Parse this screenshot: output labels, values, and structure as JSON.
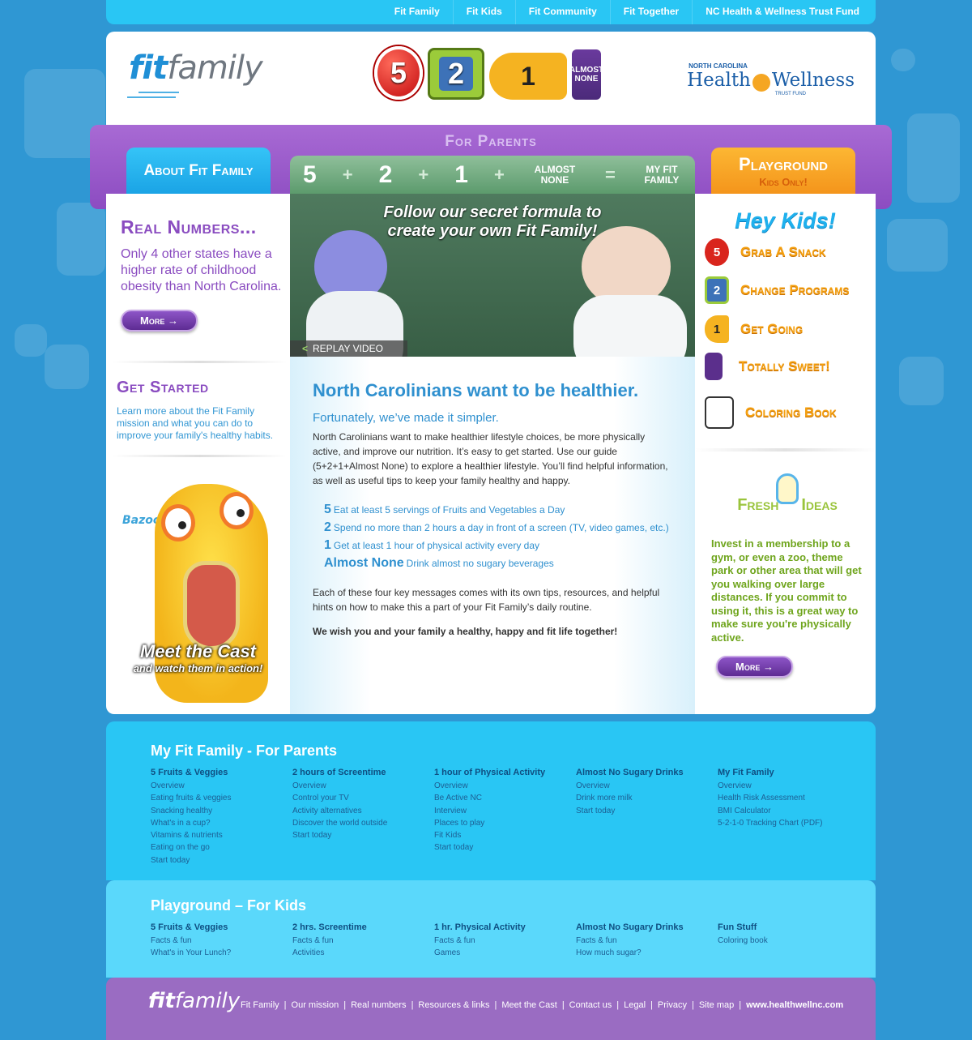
{
  "top_nav": [
    "Fit Family",
    "Fit Kids",
    "Fit Community",
    "Fit Together",
    "NC Health & Wellness Trust Fund"
  ],
  "logo": {
    "fit": "fit",
    "family": "family"
  },
  "badges": {
    "five": "5",
    "two": "2",
    "one": "1",
    "none": "ALMOST NONE"
  },
  "trust": {
    "nc": "NORTH CAROLINA",
    "health": "Health",
    "wellness": "Wellness",
    "fund": "TRUST FUND"
  },
  "band": {
    "for_parents": "For Parents",
    "about_tab": "About Fit Family",
    "playground_tab": "Playground",
    "kids_only": "Kids Only!",
    "formula": {
      "five": "5",
      "two": "2",
      "one": "1",
      "plus": "+",
      "equals": "=",
      "almost_none": "ALMOST NONE",
      "my_fit_family": "MY FIT FAMILY"
    }
  },
  "real_numbers": {
    "title": "Real Numbers...",
    "text": "Only 4 other states have a higher rate of childhood obesity than North Carolina.",
    "more": "More →"
  },
  "get_started": {
    "title": "Get Started",
    "text": "Learn more about the Fit Family mission and what you can do to improve your family's healthy habits."
  },
  "cast": {
    "name": "Bazoo",
    "line1": "Meet the Cast",
    "line2": "and watch them in action!"
  },
  "video": {
    "caption": "Follow our secret formula to create your own Fit Family!",
    "replay_arrow": "<",
    "replay": "REPLAY VIDEO"
  },
  "article": {
    "title": "North Carolinians want to be healthier.",
    "subtitle": "Fortunately, we’ve made it simpler.",
    "intro": "North Carolinians want to make healthier lifestyle choices, be more physically active, and improve our nutrition. It’s easy to get started. Use our guide (5+2+1+Almost None) to explore a healthier lifestyle. You’ll find helpful information, as well as useful tips to keep your family healthy and happy.",
    "items": [
      {
        "key": "5",
        "text": "Eat at least 5 servings of Fruits and Vegetables a Day"
      },
      {
        "key": "2",
        "text": "Spend no more than 2 hours a day in front of a screen (TV, video games, etc.)"
      },
      {
        "key": "1",
        "text": "Get at least 1 hour of physical activity every day"
      },
      {
        "key": "Almost None",
        "text": "Drink almost no sugary beverages"
      }
    ],
    "key_messages": "Each of these four key messages comes with its own tips, resources, and helpful hints on how to make this a part of your Fit Family’s daily routine.",
    "wish": "We wish you and your family a healthy, happy and fit life together!"
  },
  "kids": {
    "title": "Hey Kids!",
    "items": [
      {
        "label": "Grab A Snack",
        "icon": "apple-5-icon",
        "badge": "5"
      },
      {
        "label": "Change Programs",
        "icon": "tv-2-icon",
        "badge": "2"
      },
      {
        "label": "Get Going",
        "icon": "sneaker-1-icon",
        "badge": "1"
      },
      {
        "label": "Totally Sweet!",
        "icon": "soda-can-icon",
        "badge": ""
      },
      {
        "label": "Coloring Book",
        "icon": "coloring-book-icon",
        "badge": ""
      }
    ]
  },
  "fresh_ideas": {
    "fresh": "Fresh",
    "ideas": "Ideas",
    "text": "Invest in a membership to a gym, or even a zoo, theme park or other area that will get you walking over large distances. If you commit to using it, this is a great way to make sure you're physically active.",
    "more": "More →"
  },
  "footer_parents": {
    "title": "My Fit Family - For Parents",
    "columns": [
      {
        "title": "5 Fruits & Veggies",
        "links": [
          "Overview",
          "Eating fruits & veggies",
          "Snacking healthy",
          "What's in a cup?",
          "Vitamins & nutrients",
          "Eating on the go",
          "Start today"
        ]
      },
      {
        "title": "2 hours of Screentime",
        "links": [
          "Overview",
          "Control your TV",
          "Activity alternatives",
          "Discover the world outside",
          "Start today"
        ]
      },
      {
        "title": "1 hour of Physical Activity",
        "links": [
          "Overview",
          "Be Active NC",
          "Interview",
          "Places to play",
          "Fit Kids",
          "Start today"
        ]
      },
      {
        "title": "Almost No Sugary Drinks",
        "links": [
          "Overview",
          "Drink more milk",
          "Start today"
        ]
      },
      {
        "title": "My Fit Family",
        "links": [
          "Overview",
          "Health Risk Assessment",
          "BMI Calculator",
          "5-2-1-0 Tracking Chart (PDF)"
        ]
      }
    ]
  },
  "footer_kids": {
    "title": "Playground – For Kids",
    "columns": [
      {
        "title": "5 Fruits & Veggies",
        "links": [
          "Facts & fun",
          "What's in Your Lunch?"
        ]
      },
      {
        "title": "2 hrs. Screentime",
        "links": [
          "Facts & fun",
          "Activities"
        ]
      },
      {
        "title": "1 hr. Physical Activity",
        "links": [
          "Facts & fun",
          "Games"
        ]
      },
      {
        "title": "Almost No Sugary Drinks",
        "links": [
          "Facts & fun",
          "How much sugar?"
        ]
      },
      {
        "title": "Fun Stuff",
        "links": [
          "Coloring book"
        ]
      }
    ]
  },
  "bottom_links": [
    "Fit Family",
    "Our mission",
    "Real numbers",
    "Resources & links",
    "Meet the Cast",
    "Contact us",
    "Legal",
    "Privacy",
    "Site map",
    "www.healthwellnc.com"
  ],
  "colors": {
    "sky": "#2f97d3",
    "cyan": "#29c6f4",
    "purple": "#8a4cc0",
    "orange": "#f5a00f",
    "green": "#6fa51d"
  }
}
